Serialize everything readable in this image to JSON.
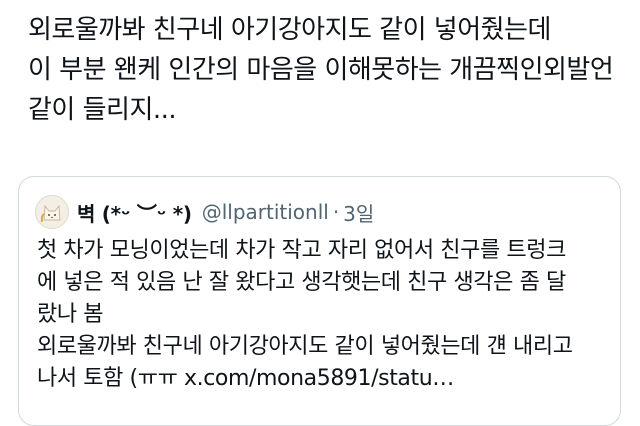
{
  "tweet": {
    "lines": [
      "외로울까봐 친구네 아기강아지도 같이 넣어줬는데",
      "이 부분 왠케 인간의 마음을 이해못하는 개끔찍인외발언",
      "같이 들리지..."
    ]
  },
  "quote": {
    "display_name": "벽 (*ᵕ ︶ᵕ *)",
    "handle": "@llpartitionll",
    "separator": "·",
    "time": "3일",
    "avatar_icon": "cat-avatar-icon",
    "lines": [
      "첫 차가 모닝이었는데 차가 작고 자리 없어서 친구를 트렁크",
      "에 넣은 적 있음 난 잘 왔다고 생각햇는데 친구 생각은 좀 달",
      "랐나 봄",
      "외로울까봐 친구네 아기강아지도 같이 넣어줬는데 걘 내리고",
      "나서 토함 (ㅠㅠ x.com/mona5891/statu…"
    ]
  },
  "colors": {
    "text": "#0f1419",
    "secondary": "#536471",
    "border": "#cfd9de"
  }
}
